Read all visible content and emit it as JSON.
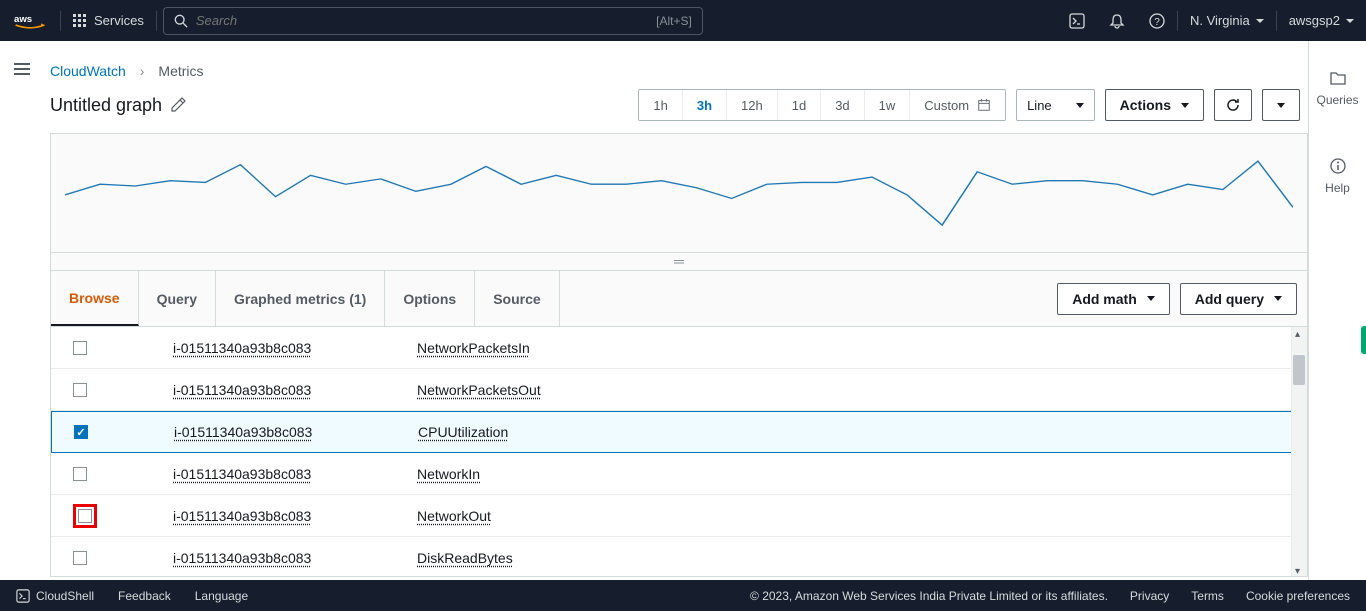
{
  "topnav": {
    "services_label": "Services",
    "search_placeholder": "Search",
    "search_shortcut": "[Alt+S]",
    "region": "N. Virginia",
    "account": "awsgsp2"
  },
  "sidebar_right": {
    "queries": "Queries",
    "help": "Help"
  },
  "breadcrumb": {
    "root": "CloudWatch",
    "current": "Metrics"
  },
  "graph": {
    "title": "Untitled graph"
  },
  "time_ranges": [
    "1h",
    "3h",
    "12h",
    "1d",
    "3d",
    "1w"
  ],
  "time_active": "3h",
  "custom_label": "Custom",
  "chart_type": "Line",
  "actions_label": "Actions",
  "tabs": {
    "browse": "Browse",
    "query": "Query",
    "graphed": "Graphed metrics (1)",
    "options": "Options",
    "source": "Source"
  },
  "add_math": "Add math",
  "add_query": "Add query",
  "instance_id": "i-01511340a93b8c083",
  "metrics": [
    {
      "name": "NetworkPacketsIn",
      "checked": false,
      "highlight": false
    },
    {
      "name": "NetworkPacketsOut",
      "checked": false,
      "highlight": false
    },
    {
      "name": "CPUUtilization",
      "checked": true,
      "highlight": false
    },
    {
      "name": "NetworkIn",
      "checked": false,
      "highlight": false
    },
    {
      "name": "NetworkOut",
      "checked": false,
      "highlight": true
    },
    {
      "name": "DiskReadBytes",
      "checked": false,
      "highlight": false
    }
  ],
  "footer": {
    "cloudshell": "CloudShell",
    "feedback": "Feedback",
    "language": "Language",
    "copyright": "© 2023, Amazon Web Services India Private Limited or its affiliates.",
    "privacy": "Privacy",
    "terms": "Terms",
    "cookies": "Cookie preferences"
  },
  "chart_data": {
    "type": "line",
    "title": "",
    "x": [
      0,
      1,
      2,
      3,
      4,
      5,
      6,
      7,
      8,
      9,
      10,
      11,
      12,
      13,
      14,
      15,
      16,
      17,
      18,
      19,
      20,
      21,
      22,
      23,
      24,
      25,
      26,
      27,
      28,
      29,
      30,
      31,
      32,
      33,
      34,
      35
    ],
    "values": [
      44,
      56,
      54,
      60,
      58,
      78,
      42,
      66,
      56,
      62,
      48,
      56,
      76,
      56,
      66,
      56,
      56,
      60,
      52,
      40,
      56,
      58,
      58,
      64,
      44,
      10,
      70,
      56,
      60,
      60,
      56,
      44,
      56,
      50,
      82,
      30
    ],
    "ylim": [
      0,
      90
    ]
  }
}
